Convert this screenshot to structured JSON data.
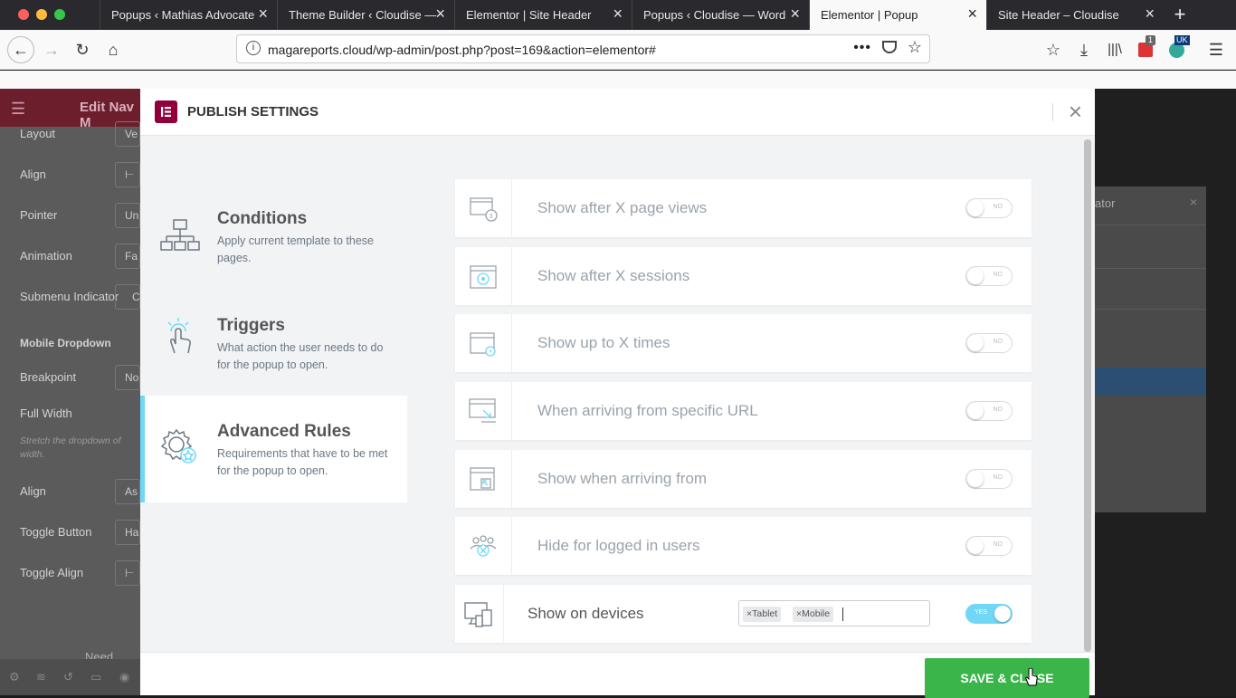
{
  "browser": {
    "tabs": [
      {
        "label": "Popups ‹ Mathias Advocate"
      },
      {
        "label": "Theme Builder ‹ Cloudise —"
      },
      {
        "label": "Elementor | Site Header"
      },
      {
        "label": "Popups ‹ Cloudise — Word"
      },
      {
        "label": "Elementor | Popup"
      },
      {
        "label": "Site Header – Cloudise"
      }
    ],
    "active_tab": 4,
    "url": "magareports.cloud/wp-admin/post.php?post=169&action=elementor#",
    "notification_badge": "1",
    "account_badge": "UK"
  },
  "editor_panel": {
    "title": "Edit Nav M",
    "fields": [
      {
        "label": "Layout",
        "value": "Ve"
      },
      {
        "label": "Align",
        "value": "⊢"
      },
      {
        "label": "Pointer",
        "value": "Un"
      },
      {
        "label": "Animation",
        "value": "Fa"
      },
      {
        "label": "Submenu Indicator",
        "value": "C"
      },
      {
        "label": "Mobile Dropdown",
        "value": ""
      },
      {
        "label": "Breakpoint",
        "value": "No"
      },
      {
        "label": "Full Width",
        "value": ""
      },
      {
        "label": "Stretch the dropdown of",
        "value": ""
      },
      {
        "label": "width.",
        "value": ""
      },
      {
        "label": "Align",
        "value": "As"
      },
      {
        "label": "Toggle Button",
        "value": "Ha"
      },
      {
        "label": "Toggle Align",
        "value": "⊢"
      },
      {
        "label": "Need Help",
        "value": ""
      }
    ]
  },
  "preview": {
    "navigator_label": "ator"
  },
  "modal": {
    "title": "PUBLISH SETTINGS",
    "tabs": [
      {
        "title": "Conditions",
        "description": "Apply current template to these pages."
      },
      {
        "title": "Triggers",
        "description": "What action the user needs to do for the popup to open."
      },
      {
        "title": "Advanced Rules",
        "description": "Requirements that have to be met for the popup to open."
      }
    ],
    "active_tab": 2,
    "rules": [
      {
        "label": "Show after X page views",
        "icon": "page-views-icon",
        "state": "NO"
      },
      {
        "label": "Show after X sessions",
        "icon": "sessions-icon",
        "state": "NO"
      },
      {
        "label": "Show up to X times",
        "icon": "times-icon",
        "state": "NO"
      },
      {
        "label": "When arriving from specific URL",
        "icon": "url-icon",
        "state": "NO"
      },
      {
        "label": "Show when arriving from",
        "icon": "arriving-from-icon",
        "state": "NO"
      },
      {
        "label": "Hide for logged in users",
        "icon": "logged-in-users-icon",
        "state": "NO"
      },
      {
        "label": "Show on devices",
        "icon": "devices-icon",
        "state": "YES"
      }
    ],
    "devices": [
      {
        "label": "Tablet",
        "remove": "×"
      },
      {
        "label": "Mobile",
        "remove": "×"
      }
    ],
    "save_button": "SAVE & CLOSE"
  },
  "colors": {
    "save_green": "#39b54a",
    "toggle_on": "#71d7f7",
    "elementor_logo": "#92003b"
  }
}
